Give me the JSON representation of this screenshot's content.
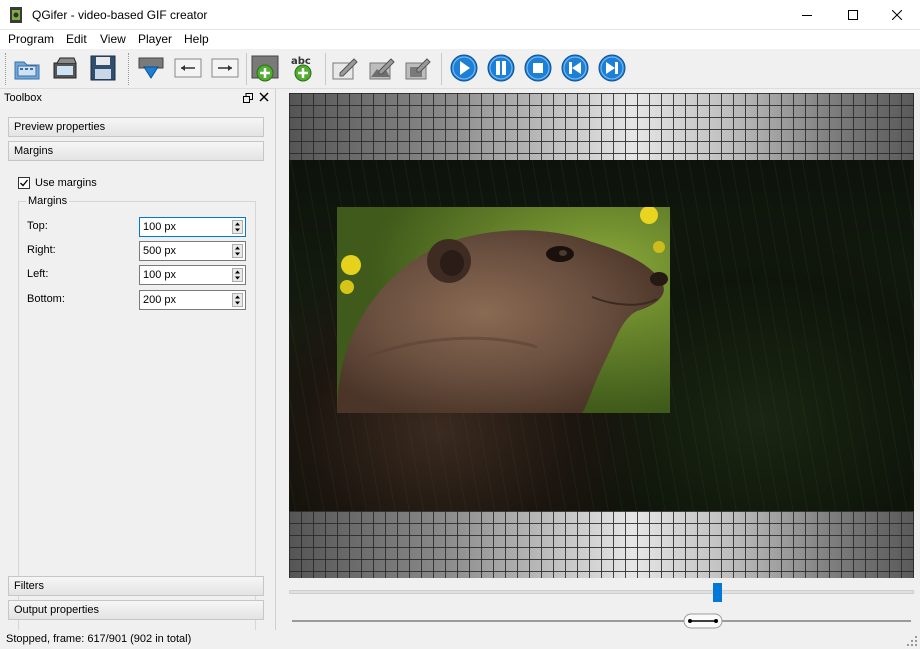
{
  "window": {
    "title": "QGifer - video-based GIF creator",
    "icon": "qgifer-app-icon"
  },
  "menu": [
    "Program",
    "Edit",
    "View",
    "Player",
    "Help"
  ],
  "toolbar": {
    "icons": [
      "open-video-icon",
      "open-project-icon",
      "save-icon",
      "extract-gif-icon",
      "set-start-icon",
      "set-end-icon",
      "add-object-icon",
      "add-text-icon",
      "edit-icon",
      "edit-objects-icon",
      "edit-frames-icon",
      "play-icon",
      "pause-icon",
      "stop-icon",
      "previous-icon",
      "next-icon"
    ]
  },
  "toolbox": {
    "title": "Toolbox",
    "sections": [
      "Preview properties",
      "Margins",
      "Filters",
      "Output properties"
    ],
    "use_margins_label": "Use margins",
    "use_margins_checked": true,
    "group_title": "Margins",
    "fields": [
      {
        "label": "Top:",
        "value": "100 px"
      },
      {
        "label": "Right:",
        "value": "500 px"
      },
      {
        "label": "Left:",
        "value": "100 px"
      },
      {
        "label": "Bottom:",
        "value": "200 px"
      }
    ]
  },
  "player": {
    "position_fraction": 0.685
  },
  "status": {
    "text": "Stopped, frame: 617/901 (902 in total)"
  },
  "colors": {
    "accent": "#0078d7",
    "play_buttons": "#1e7fd6"
  }
}
